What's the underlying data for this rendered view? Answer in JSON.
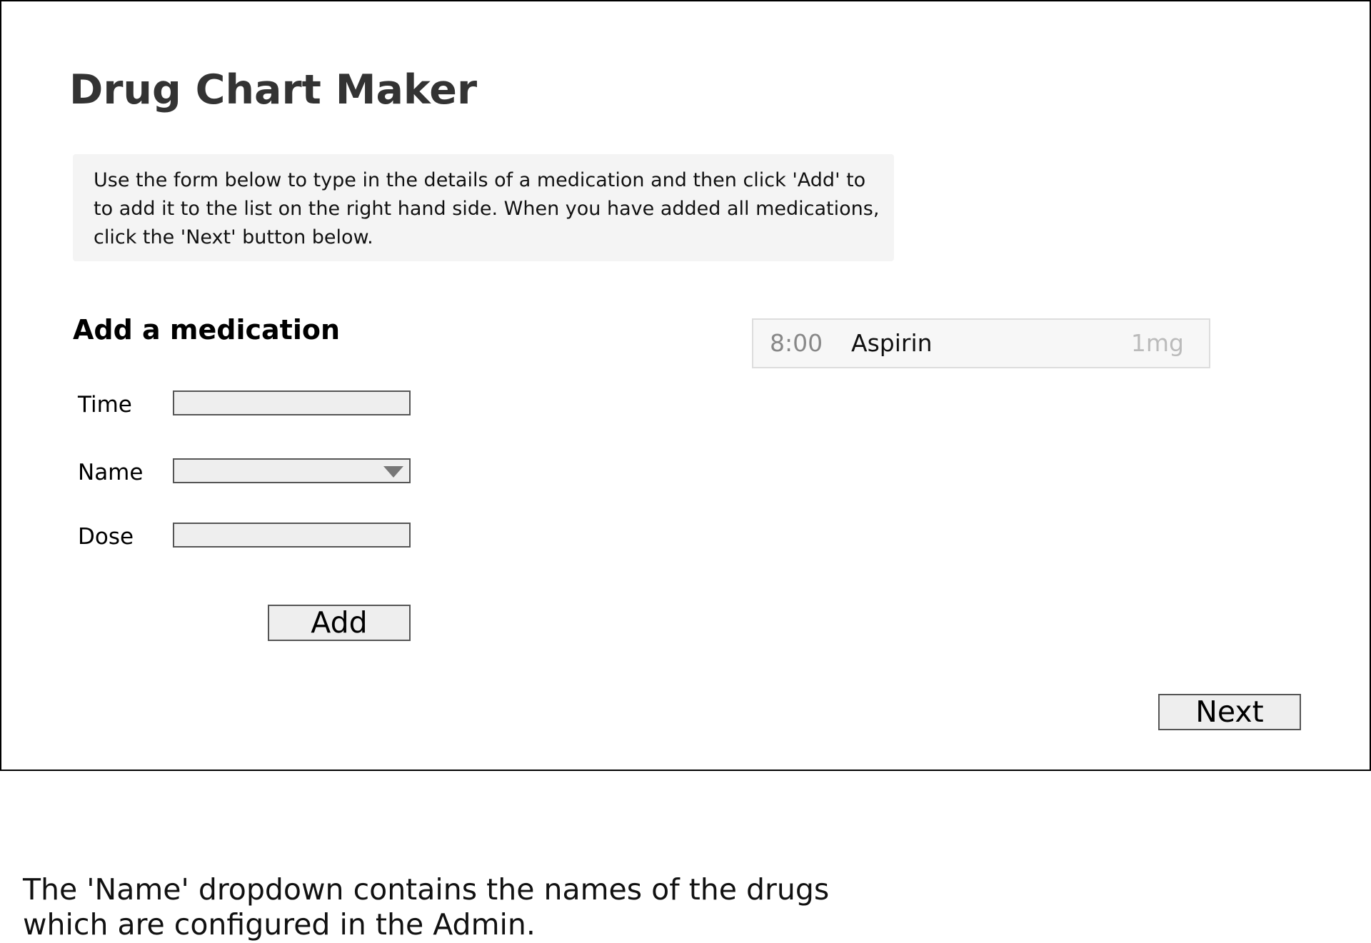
{
  "app": {
    "title": "Drug Chart Maker"
  },
  "instructions": {
    "lines": [
      "Use the form below to type in the details of a medication and then click 'Add' to",
      "to add it to the list on the right hand side. When you have added all medications,",
      "click the 'Next' button below."
    ]
  },
  "form": {
    "heading": "Add a medication",
    "time_label": "Time",
    "time_value": "",
    "name_label": "Name",
    "name_selected": "",
    "dose_label": "Dose",
    "dose_value": "",
    "add_label": "Add"
  },
  "medications": [
    {
      "time": "8:00",
      "name": "Aspirin",
      "dose": "1mg"
    }
  ],
  "footer": {
    "next_label": "Next"
  },
  "note": {
    "lines": [
      "The 'Name' dropdown contains the names of the drugs",
      "which are configured in the Admin."
    ]
  },
  "icons": {
    "dropdown": "chevron-down-icon"
  }
}
